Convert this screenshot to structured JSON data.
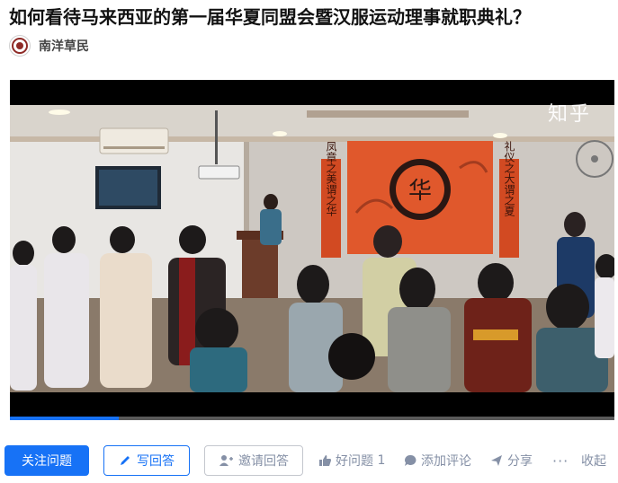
{
  "question": {
    "title": "如何看待马来西亚的第一届华夏同盟会暨汉服运动理事就职典礼？"
  },
  "author": {
    "name": "南洋草民",
    "avatar_icon": "avatar-logo-icon"
  },
  "video": {
    "watermark": "知乎",
    "banner_left": "凤章之美谓之华",
    "banner_right": "礼仪之大谓之夏",
    "emblem_char": "华",
    "progress_fraction": 0.18
  },
  "actions": {
    "follow_label": "关注问题",
    "write_label": "写回答",
    "invite_label": "邀请回答",
    "good_label": "好问题",
    "good_count": "1",
    "comment_label": "添加评论",
    "share_label": "分享",
    "more_label": "···",
    "collapse_label": "收起"
  },
  "colors": {
    "accent": "#1772f6",
    "muted": "#8590a6",
    "banner": "#e0582c"
  }
}
